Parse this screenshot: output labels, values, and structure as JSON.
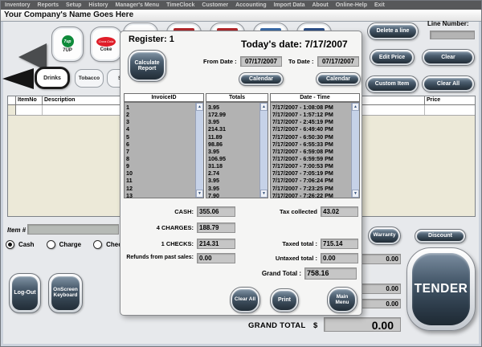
{
  "menu": {
    "items": [
      "Inventory",
      "Reports",
      "Setup",
      "History",
      "Manager's Menu",
      "TimeClock",
      "Customer",
      "Accounting",
      "Import Data",
      "About",
      "Online-Help",
      "Exit"
    ]
  },
  "company_bar": {
    "title": "Your Company's Name Goes Here"
  },
  "products": {
    "seven_up": {
      "label": "7UP",
      "logo_text": "7up"
    },
    "coke": {
      "label": "Coke",
      "logo_text": "Coca Cola"
    },
    "partial_logo_colors": [
      "",
      "#b3282c",
      "#b3282c",
      "#3a6ca8",
      "#2c4f88"
    ]
  },
  "tabs": {
    "items": [
      {
        "label": "Drinks",
        "active": true
      },
      {
        "label": "Tobacco",
        "active": false
      },
      {
        "label": "Se",
        "active": false
      }
    ]
  },
  "sales_grid": {
    "columns": {
      "itemno": "ItemNo",
      "description": "Description",
      "price": "Price"
    }
  },
  "item_entry": {
    "label": "Item #",
    "value": ""
  },
  "payment_options": [
    {
      "label": "Cash",
      "selected": true
    },
    {
      "label": "Charge",
      "selected": false
    },
    {
      "label": "Check",
      "selected": false
    }
  ],
  "left_buttons": {
    "logout": "Log-Out",
    "onscreen_keyboard": "OnScreen Keyboard"
  },
  "right_panel": {
    "line_number_label": "Line Number:",
    "line_number_value": "",
    "delete_line": "Delete a line",
    "edit_price": "Edit Price",
    "clear": "Clear",
    "custom_item": "Custom Item",
    "clear_all": "Clear All",
    "warranty": "Warranty",
    "discount": "Discount",
    "tender": "TENDER",
    "side_field_values": [
      "0.00",
      "0.00",
      "0.00"
    ]
  },
  "grand_total": {
    "label": "GRAND TOTAL",
    "currency": "$",
    "value": "0.00"
  },
  "colors": {
    "button_dark": "#33424f",
    "table_bg": "#ece9d8",
    "field_bg": "#c7c7c7",
    "list_bg": "#b2b2b2"
  },
  "dialog": {
    "register_label": "Register: 1",
    "todays_date": "Today's date: 7/17/2007",
    "calculate_report": "Calculate Report",
    "from_date": {
      "label": "From Date :",
      "value": "07/17/2007"
    },
    "to_date": {
      "label": "To Date :",
      "value": "07/17/2007"
    },
    "calendar_label": "Calendar",
    "invoice_table": {
      "headers": {
        "id": "InvoiceID",
        "totals": "Totals",
        "datetime": "Date - Time"
      },
      "invoice_ids": [
        "1",
        "2",
        "3",
        "4",
        "5",
        "6",
        "7",
        "8",
        "9",
        "10",
        "11",
        "12",
        "13"
      ],
      "totals": [
        "3.95",
        "172.99",
        "3.95",
        "214.31",
        "11.89",
        "98.86",
        "3.95",
        "106.95",
        "31.18",
        "2.74",
        "3.95",
        "3.95",
        "7.90"
      ],
      "datetimes": [
        "7/17/2007 - 1:08:08 PM",
        "7/17/2007 - 1:57:12 PM",
        "7/17/2007 - 2:45:19 PM",
        "7/17/2007 - 6:49:40 PM",
        "7/17/2007 - 6:50:30 PM",
        "7/17/2007 - 6:55:33 PM",
        "7/17/2007 - 6:59:08 PM",
        "7/17/2007 - 6:59:59 PM",
        "7/17/2007 - 7:00:53 PM",
        "7/17/2007 - 7:05:19 PM",
        "7/17/2007 - 7:06:24 PM",
        "7/17/2007 - 7:23:25 PM",
        "7/17/2007 - 7:26:22 PM"
      ]
    },
    "summary": {
      "cash": {
        "label": "CASH:",
        "value": "355.06"
      },
      "charges": {
        "label": "4 CHARGES:",
        "value": "188.79"
      },
      "checks": {
        "label": "1 CHECKS:",
        "value": "214.31"
      },
      "refunds": {
        "label": "Refunds from past sales:",
        "value": "0.00"
      },
      "tax": {
        "label": "Tax collected",
        "value": "43.02"
      },
      "taxed": {
        "label": "Taxed total :",
        "value": "715.14"
      },
      "untaxed": {
        "label": "Untaxed total :",
        "value": "0.00"
      },
      "grand": {
        "label": "Grand Total :",
        "value": "758.16"
      }
    },
    "footer_buttons": {
      "clear_all": "Clear All",
      "print": "Print",
      "main_menu": "Main Menu"
    }
  }
}
